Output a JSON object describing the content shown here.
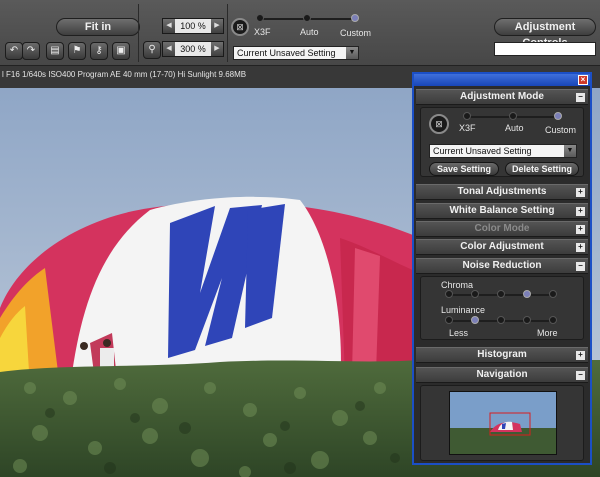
{
  "toolbar": {
    "fit_label": "Fit in",
    "zoom_value": "100 %",
    "zoom2_value": "300 %",
    "adjustment_controls_label": "Adjustment Controls",
    "mode_setting_value": "Current Unsaved Setting",
    "mode_labels": {
      "x3f": "X3F",
      "auto": "Auto",
      "custom": "Custom"
    },
    "selected_mode": "Custom"
  },
  "infobar": {
    "text": "l F16 1/640s ISO400 Program AE 40 mm (17-70) Hi Sunlight 9.68MB"
  },
  "panel": {
    "adjustment_mode": {
      "title": "Adjustment Mode",
      "labels": {
        "x3f": "X3F",
        "auto": "Auto",
        "custom": "Custom"
      },
      "selected": "Custom",
      "setting_value": "Current Unsaved Setting",
      "save_label": "Save Setting",
      "delete_label": "Delete Setting"
    },
    "sections": {
      "tonal": "Tonal Adjustments",
      "white_balance": "White Balance Setting",
      "color_mode": "Color Mode",
      "color_adjustment": "Color Adjustment",
      "noise_reduction": "Noise Reduction",
      "histogram": "Histogram",
      "navigation": "Navigation"
    },
    "noise_reduction": {
      "chroma_label": "Chroma",
      "luminance_label": "Luminance",
      "less_label": "Less",
      "more_label": "More",
      "chroma_level": 3,
      "luminance_level": 1,
      "steps": 5
    }
  },
  "colors": {
    "panel_border": "#1b4fc6",
    "slider_selected": "#7b7fb8",
    "nav_rect": "#d81e1e"
  },
  "icons": [
    "rotate-left-icon",
    "rotate-right-icon",
    "print-icon",
    "flag-icon",
    "key-icon",
    "lock-icon",
    "magnifier-icon",
    "x3f-icon",
    "close-icon",
    "expand-icon",
    "collapse-icon"
  ]
}
